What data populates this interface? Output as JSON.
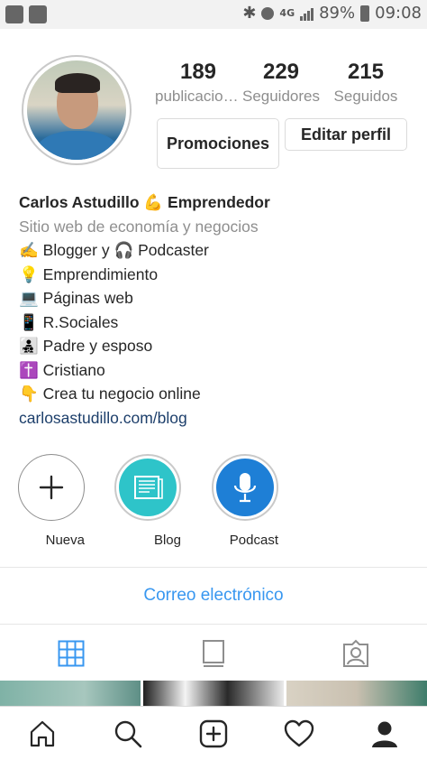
{
  "status_bar": {
    "left_icons": [
      "image-notification-icon",
      "calendar-notification-icon"
    ],
    "right_icons": [
      "bluetooth-icon",
      "alarm-icon",
      "signal-4g-icon",
      "signal-bars-icon",
      "battery-icon"
    ],
    "network": "4G",
    "battery": "89%",
    "time": "09:08"
  },
  "profile": {
    "stats": [
      {
        "value": "189",
        "label": "publicaciones"
      },
      {
        "value": "229",
        "label": "Seguidores"
      },
      {
        "value": "215",
        "label": "Seguidos"
      }
    ],
    "buttons": {
      "promotions": "Promociones",
      "edit_profile": "Editar perfil"
    }
  },
  "bio": {
    "name": "Carlos Astudillo 💪 Emprendedor",
    "category": "Sitio web de economía y negocios",
    "lines": [
      "✍️ Blogger  y 🎧 Podcaster",
      "💡 Emprendimiento",
      "💻 Páginas web",
      "📱 R.Sociales",
      "👨‍👧‍👦 Padre y esposo",
      "✝️ Cristiano",
      "👇 Crea tu negocio online"
    ],
    "link": "carlosastudillo.com/blog"
  },
  "highlights": [
    {
      "label": "Nueva",
      "icon": "plus-icon"
    },
    {
      "label": "Blog",
      "icon": "document-icon",
      "color": "#2ec4c9"
    },
    {
      "label": "Podcast",
      "icon": "microphone-icon",
      "color": "#1e7fd6"
    }
  ],
  "contact": {
    "email_label": "Correo electrónico",
    "color": "#3897f0"
  },
  "tabs": [
    {
      "icon": "grid-icon",
      "active": true
    },
    {
      "icon": "feed-icon",
      "active": false
    },
    {
      "icon": "tagged-icon",
      "active": false
    }
  ],
  "bottom_nav": [
    "home-icon",
    "search-icon",
    "add-post-icon",
    "heart-icon",
    "profile-icon"
  ],
  "colors": {
    "accent": "#3897f0",
    "muted": "#8e8e8e",
    "text": "#262626",
    "link": "#1d3f6b"
  }
}
